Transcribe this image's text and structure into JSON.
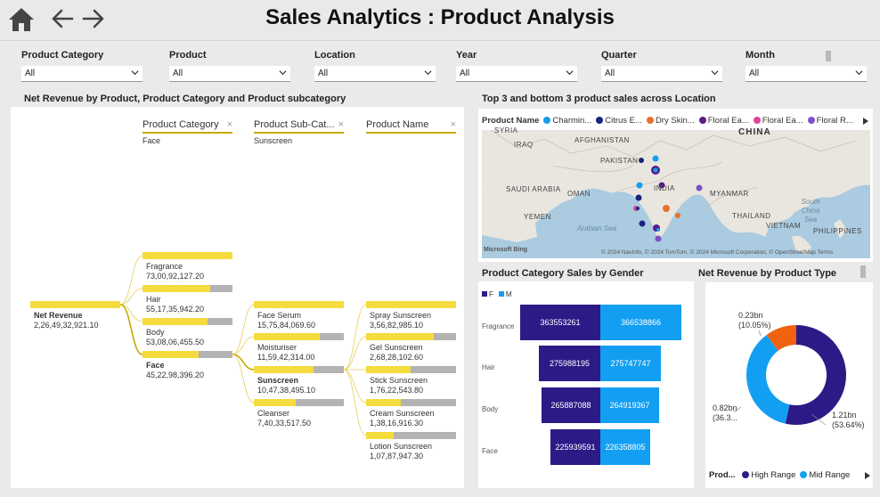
{
  "header": {
    "title": "Sales Analytics : Product Analysis",
    "home_icon": "home-icon",
    "back_icon": "arrow-left-icon",
    "forward_icon": "arrow-right-icon"
  },
  "slicers": [
    {
      "label": "Product Category",
      "value": "All"
    },
    {
      "label": "Product",
      "value": "All"
    },
    {
      "label": "Location",
      "value": "All"
    },
    {
      "label": "Year",
      "value": "All"
    },
    {
      "label": "Quarter",
      "value": "All"
    },
    {
      "label": "Month",
      "value": "All"
    }
  ],
  "decomp": {
    "title": "Net Revenue  by Product, Product Category and Product subcategory",
    "headers": [
      {
        "label": "Product Category",
        "filter": "Face"
      },
      {
        "label": "Product Sub-Cat...",
        "filter": "Sunscreen"
      },
      {
        "label": "Product Name",
        "filter": ""
      }
    ],
    "close_glyph": "×",
    "root": {
      "name": "Net Revenue",
      "value": "2,26,49,32,921.10"
    },
    "categories": [
      {
        "name": "Fragrance",
        "value": "73,00,92,127.20",
        "share": 1.0
      },
      {
        "name": "Hair",
        "value": "55,17,35,942.20",
        "share": 0.755
      },
      {
        "name": "Body",
        "value": "53,08,06,455.50",
        "share": 0.727
      },
      {
        "name": "Face",
        "value": "45,22,98,396.20",
        "share": 0.62
      }
    ],
    "subcategories": [
      {
        "name": "Face Serum",
        "value": "15,75,84,069.60",
        "share": 1.0
      },
      {
        "name": "Moisturiser",
        "value": "11,59,42,314.00",
        "share": 0.736
      },
      {
        "name": "Sunscreen",
        "value": "10,47,38,495.10",
        "share": 0.665
      },
      {
        "name": "Cleanser",
        "value": "7,40,33,517.50",
        "share": 0.47
      }
    ],
    "products": [
      {
        "name": "Spray Sunscreen",
        "value": "3,56,82,985.10",
        "share": 1.0
      },
      {
        "name": "Gel Sunscreen",
        "value": "2,68,28,102.60",
        "share": 0.752
      },
      {
        "name": "Stick Sunscreen",
        "value": "1,76,22,543.80",
        "share": 0.494
      },
      {
        "name": "Cream Sunscreen",
        "value": "1,38,16,916.30",
        "share": 0.387
      },
      {
        "name": "Lotion Sunscreen",
        "value": "1,07,87,947.30",
        "share": 0.302
      }
    ]
  },
  "map": {
    "title": "Top 3 and bottom 3 product sales across Location",
    "legend_title": "Product Name",
    "legend": [
      {
        "label": "Charmin...",
        "color": "#1a9be6"
      },
      {
        "label": "Citrus E...",
        "color": "#1a237e"
      },
      {
        "label": "Dry Skin...",
        "color": "#e8702a"
      },
      {
        "label": "Floral Ea...",
        "color": "#5b1a8a"
      },
      {
        "label": "Floral Ea...",
        "color": "#e0449a"
      },
      {
        "label": "Floral R...",
        "color": "#7b52c8"
      }
    ],
    "labels": {
      "syria": "SYRIA",
      "iraq": "IRAQ",
      "afghanistan": "AFGHANISTAN",
      "china": "CHINA",
      "pakistan": "PAKISTAN",
      "saudi": "SAUDI ARABIA",
      "oman": "OMAN",
      "india": "INDIA",
      "myanmar": "MYANMAR",
      "yemen": "YEMEN",
      "thailand": "THAILAND",
      "south_china_sea": "South China Sea",
      "arabian_sea": "Arabian Sea",
      "vietnam": "VIETNAM",
      "philippines": "PHILIPPINES"
    },
    "copyright": "© 2024 NavInfo, © 2024 TomTom, © 2024 Microsoft Corporation, © OpenStreetMap  Terms",
    "brand": "Microsoft Bing"
  },
  "gender": {
    "title": "Product Category Sales by Gender",
    "legend": [
      {
        "label": "F",
        "color": "#2e1a87"
      },
      {
        "label": "M",
        "color": "#139ff1"
      }
    ],
    "rows": [
      {
        "category": "Fragrance",
        "f": 363553261,
        "m": 366538866
      },
      {
        "category": "Hair",
        "f": 275988195,
        "m": 275747747
      },
      {
        "category": "Body",
        "f": 265887088,
        "m": 264919367
      },
      {
        "category": "Face",
        "f": 225939591,
        "m": 226358805
      }
    ]
  },
  "chart_data": {
    "type": "pie",
    "title": "Net Revenue by Product Type",
    "slices": [
      {
        "label": "High Range",
        "value": 1.21,
        "display": "1.21bn",
        "percent": "(53.64%)",
        "color": "#2e1a87"
      },
      {
        "label": "Mid Range",
        "value": 0.82,
        "display": "0.82bn",
        "percent": "(36.3...",
        "color": "#139ff1"
      },
      {
        "label": "",
        "value": 0.23,
        "display": "0.23bn",
        "percent": "(10.05%)",
        "color": "#f0620f"
      }
    ],
    "legend_title": "Prod...",
    "legend_placement": "bottom"
  }
}
